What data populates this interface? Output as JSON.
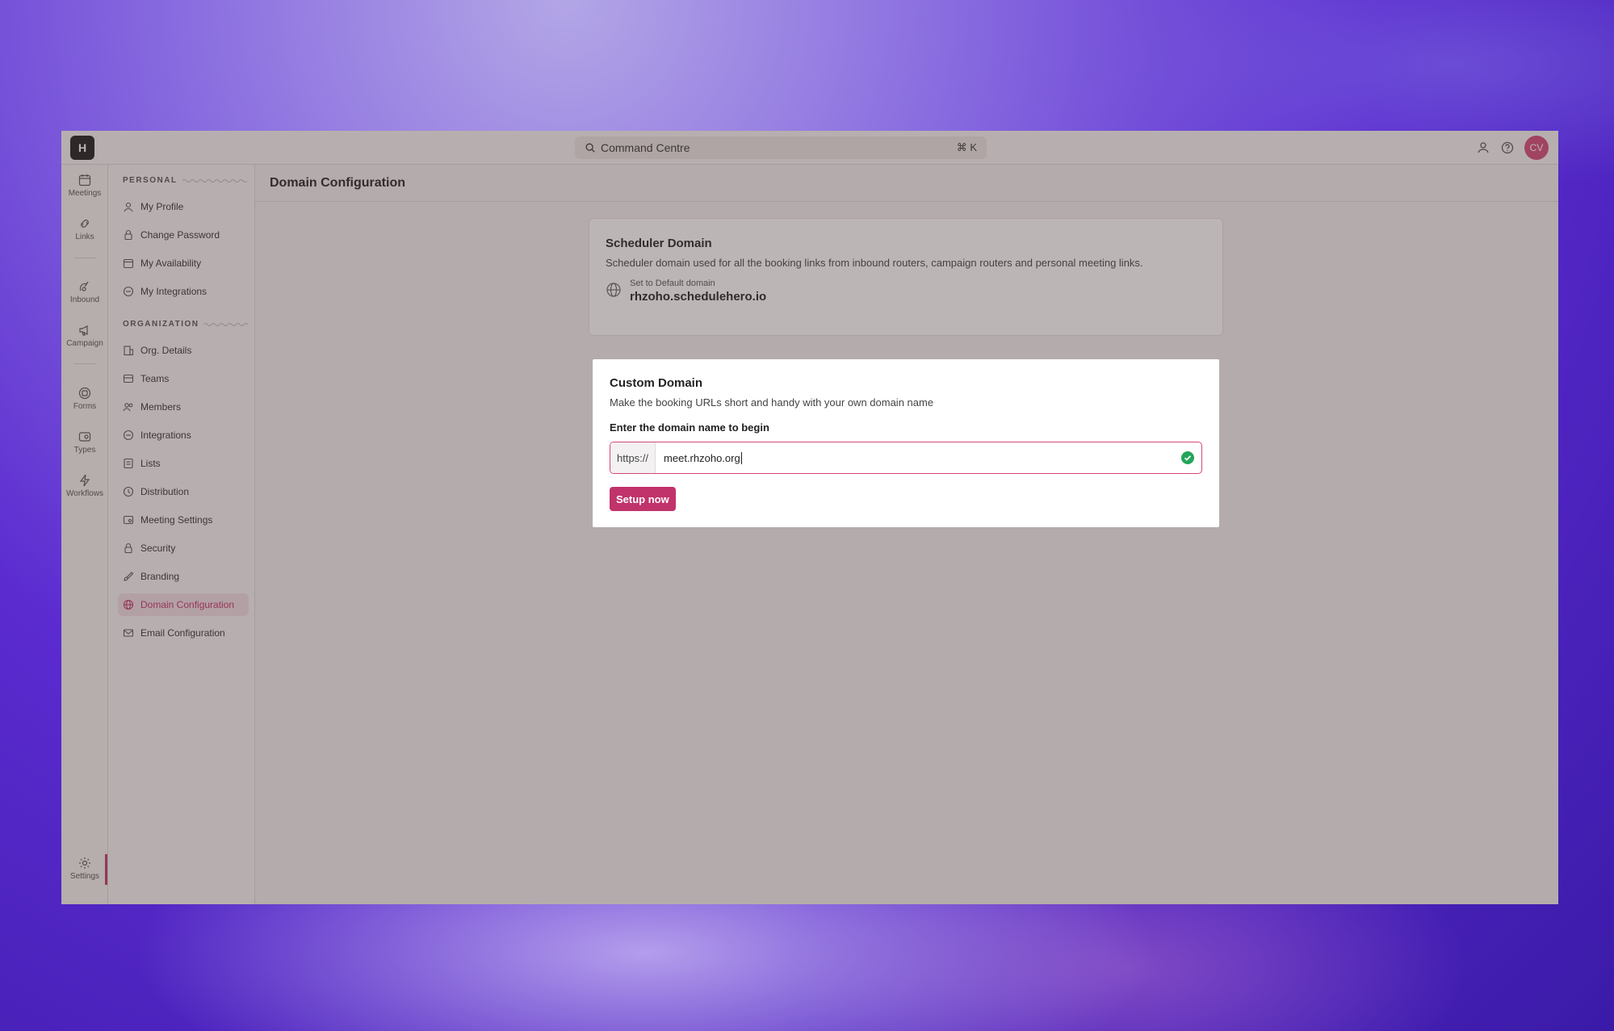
{
  "app": {
    "logo_text": "H"
  },
  "topbar": {
    "command_placeholder": "Command Centre",
    "shortcut": "⌘ K",
    "avatar_initials": "CV"
  },
  "rail": {
    "items": [
      {
        "label": "Meetings",
        "icon": "calendar-icon"
      },
      {
        "label": "Links",
        "icon": "link-icon"
      },
      {
        "label": "Inbound",
        "icon": "inbound-icon"
      },
      {
        "label": "Campaign",
        "icon": "megaphone-icon"
      },
      {
        "label": "Forms",
        "icon": "form-icon"
      },
      {
        "label": "Types",
        "icon": "types-icon"
      },
      {
        "label": "Workflows",
        "icon": "bolt-icon"
      },
      {
        "label": "Settings",
        "icon": "gear-icon"
      }
    ]
  },
  "sidebar": {
    "personal_heading": "PERSONAL",
    "org_heading": "ORGANIZATION",
    "personal": [
      {
        "label": "My Profile",
        "icon": "user-icon"
      },
      {
        "label": "Change Password",
        "icon": "lock-icon"
      },
      {
        "label": "My Availability",
        "icon": "calendar-icon"
      },
      {
        "label": "My Integrations",
        "icon": "integration-icon"
      }
    ],
    "organization": [
      {
        "label": "Org. Details",
        "icon": "building-icon"
      },
      {
        "label": "Teams",
        "icon": "teams-icon"
      },
      {
        "label": "Members",
        "icon": "members-icon"
      },
      {
        "label": "Integrations",
        "icon": "integration-icon"
      },
      {
        "label": "Lists",
        "icon": "list-icon"
      },
      {
        "label": "Distribution",
        "icon": "distribution-icon"
      },
      {
        "label": "Meeting Settings",
        "icon": "meeting-settings-icon"
      },
      {
        "label": "Security",
        "icon": "lock-icon"
      },
      {
        "label": "Branding",
        "icon": "brush-icon"
      },
      {
        "label": "Domain Configuration",
        "icon": "globe-icon",
        "active": true
      },
      {
        "label": "Email Configuration",
        "icon": "mail-icon"
      }
    ]
  },
  "main": {
    "title": "Domain Configuration",
    "scheduler": {
      "title": "Scheduler Domain",
      "description": "Scheduler domain used for all the booking links from inbound routers, campaign routers and personal meeting links.",
      "default_label": "Set to Default domain",
      "default_domain": "rhzoho.schedulehero.io"
    },
    "custom": {
      "title": "Custom Domain",
      "description": "Make the booking URLs short and handy with your own domain name",
      "field_label": "Enter the domain name to begin",
      "prefix": "https://",
      "value": "meet.rhzoho.org",
      "button": "Setup now"
    }
  },
  "colors": {
    "accent": "#c0336b",
    "success": "#22a55a"
  }
}
